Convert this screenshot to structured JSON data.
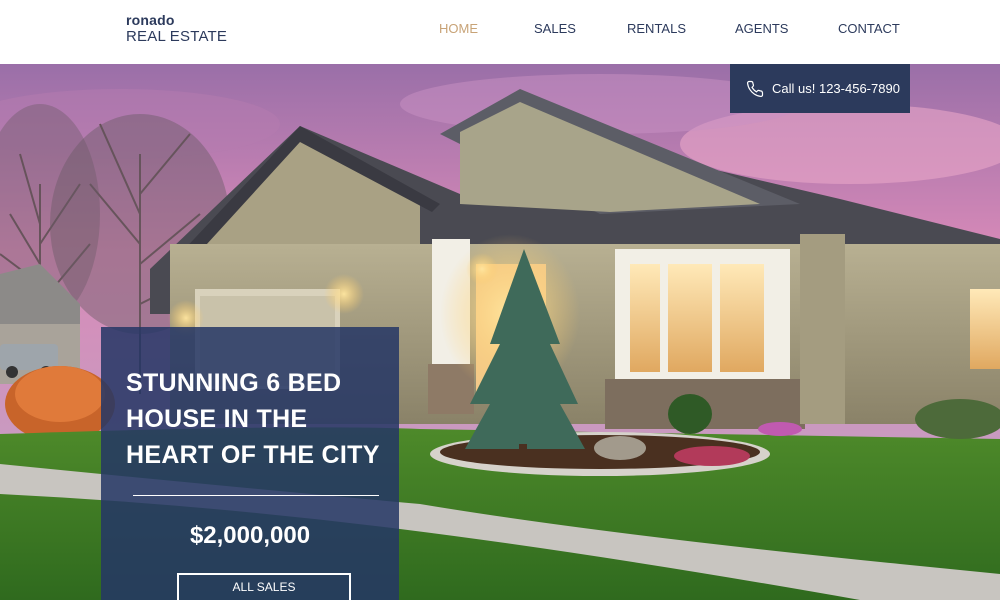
{
  "logo": {
    "line1": "ronado",
    "line2": "REAL ESTATE"
  },
  "nav": {
    "items": [
      {
        "label": "HOME",
        "active": true
      },
      {
        "label": "SALES",
        "active": false
      },
      {
        "label": "RENTALS",
        "active": false
      },
      {
        "label": "AGENTS",
        "active": false
      },
      {
        "label": "CONTACT",
        "active": false
      }
    ]
  },
  "call": {
    "label": "Call us! 123-456-7890",
    "icon": "phone-icon"
  },
  "hero_card": {
    "headline": "STUNNING 6 BED HOUSE IN THE HEART OF THE CITY",
    "price": "$2,000,000",
    "button_label": "ALL SALES"
  },
  "colors": {
    "brand_navy": "#2c3a5c",
    "nav_active": "#c8a377",
    "card_bg": "#253765"
  }
}
